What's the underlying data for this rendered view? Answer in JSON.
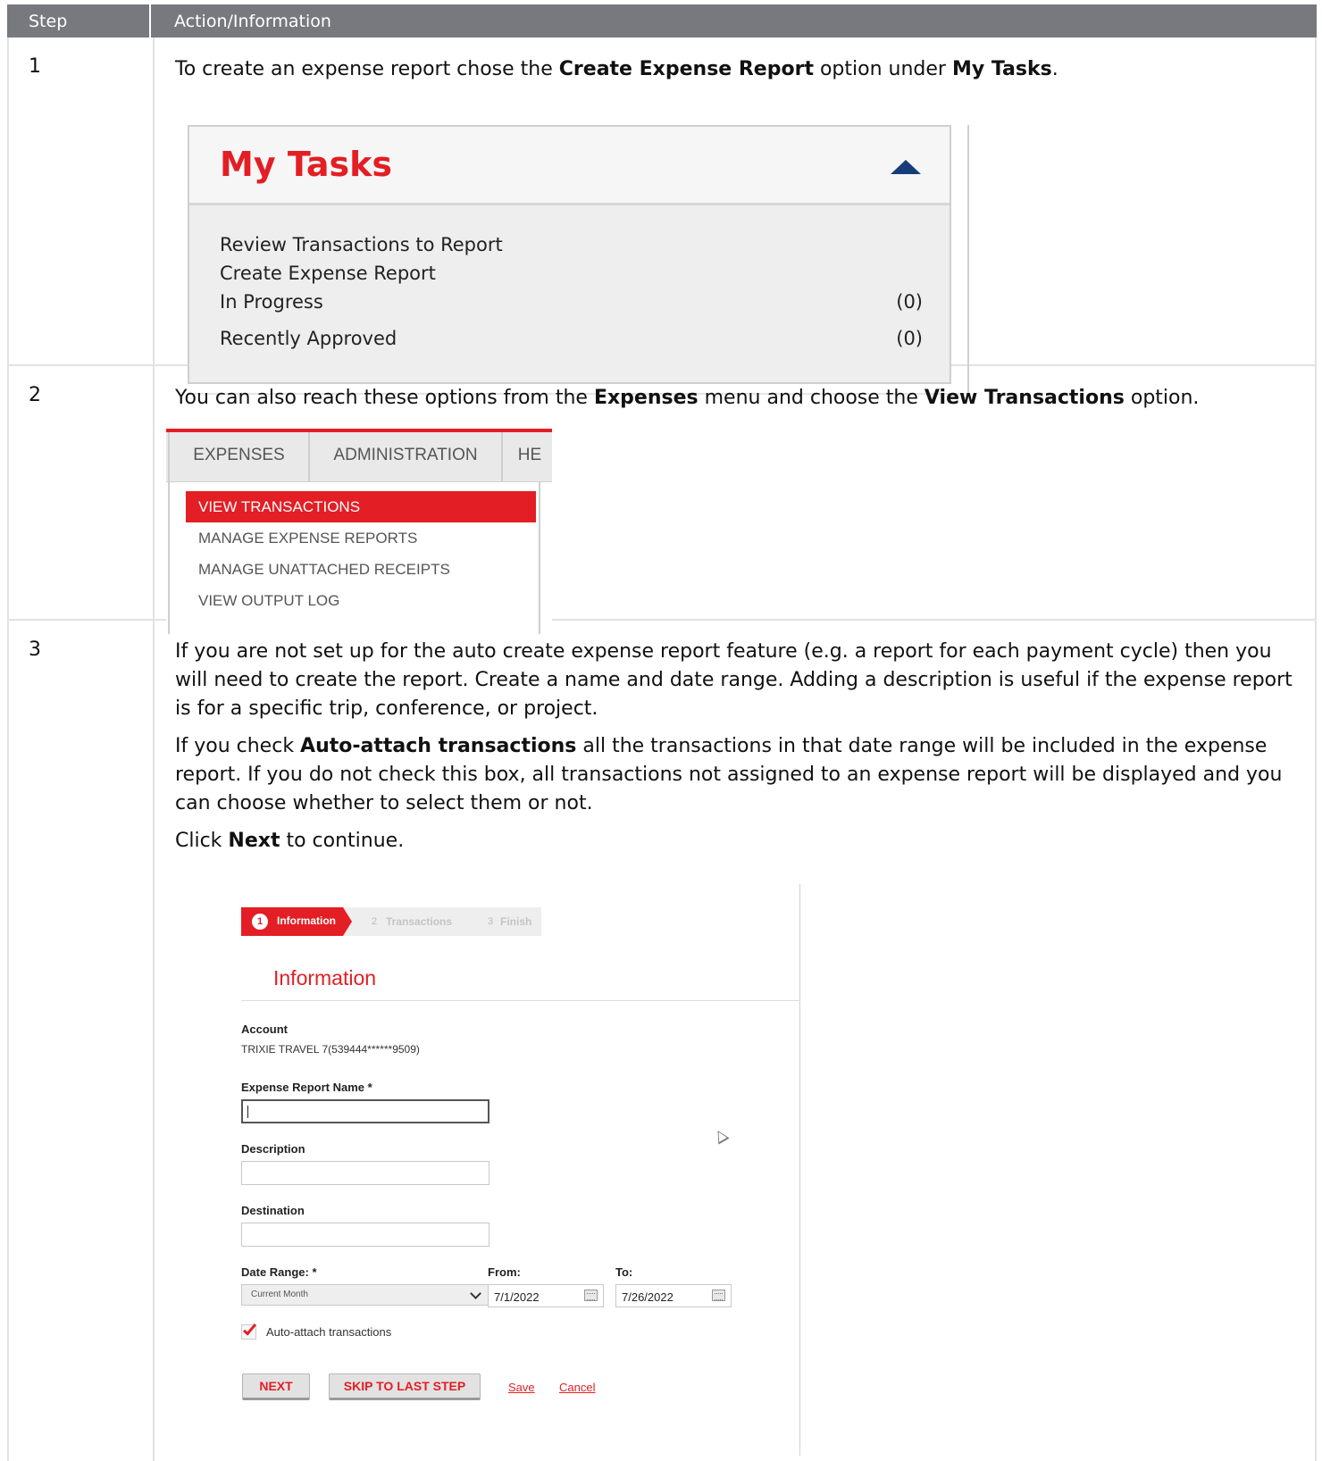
{
  "header": {
    "col_step": "Step",
    "col_action": "Action/Information"
  },
  "row1": {
    "step": "1",
    "text": {
      "a": "To create an expense report chose the ",
      "b": "Create Expense Report",
      "c": " option under ",
      "d": "My Tasks",
      "e": "."
    },
    "mytasks": {
      "title": "My Tasks",
      "items": [
        {
          "label": "Review Transactions to Report",
          "count": ""
        },
        {
          "label": "Create Expense Report",
          "count": ""
        },
        {
          "label": "In Progress",
          "count": "(0)"
        },
        {
          "label": "Recently Approved",
          "count": "(0)"
        }
      ]
    }
  },
  "row2": {
    "step": "2",
    "text": {
      "a": "You can also reach these options from the ",
      "b": "Expenses",
      "c": " menu and choose the ",
      "d": "View Transactions",
      "e": " option."
    },
    "menu": {
      "tabs": [
        "EXPENSES",
        "ADMINISTRATION",
        "HE"
      ],
      "items": [
        "VIEW TRANSACTIONS",
        "MANAGE EXPENSE REPORTS",
        "MANAGE UNATTACHED RECEIPTS",
        "VIEW OUTPUT LOG"
      ],
      "active_index": 0
    }
  },
  "row3": {
    "step": "3",
    "para1": "If you are not set up for the auto create expense report feature (e.g. a report for each payment cycle) then you will need to create the report. Create a name and date range. Adding a description is useful if the expense report is for a specific trip, conference, or project.",
    "para2": {
      "a": "If you check ",
      "b": "Auto-attach transactions",
      "c": " all the transactions in that date range will be included in the expense report. If you do not check this box, all transactions not assigned to an expense report will be displayed and you can choose whether to select them or not."
    },
    "para3": {
      "a": "Click ",
      "b": "Next",
      "c": " to continue."
    },
    "wizard": {
      "steps": [
        {
          "num": "1",
          "label": "Information"
        },
        {
          "num": "2",
          "label": "Transactions"
        },
        {
          "num": "3",
          "label": "Finish"
        }
      ],
      "title": "Information",
      "account_label": "Account",
      "account_value": "TRIXIE TRAVEL 7(539444******9509)",
      "name_label": "Expense Report Name *",
      "description_label": "Description",
      "destination_label": "Destination",
      "date_range_label": "Date Range: *",
      "date_range_value": "Current Month",
      "from_label": "From:",
      "from_value": "7/1/2022",
      "to_label": "To:",
      "to_value": "7/26/2022",
      "auto_attach_label": "Auto-attach transactions",
      "auto_attach_checked": true,
      "next_label": "NEXT",
      "skip_label": "SKIP TO LAST STEP",
      "save_label": "Save",
      "cancel_label": "Cancel"
    }
  },
  "colors": {
    "accent_red": "#e31e24",
    "header_gray": "#77797e",
    "arrow_navy": "#163d7a"
  }
}
